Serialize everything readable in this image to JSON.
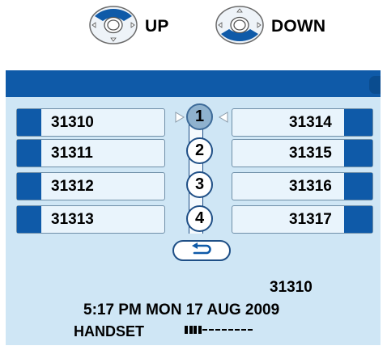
{
  "legend": {
    "up_label": "UP",
    "down_label": "DOWN",
    "up_icon": "nav-ring-up-icon",
    "down_icon": "nav-ring-down-icon"
  },
  "colors": {
    "header_blue": "#0f5aa8",
    "screen_background": "#cfe6f5",
    "key_face": "#e9f4fc",
    "selected_index": "#8fb2ce"
  },
  "line_keys": {
    "left": [
      "31310",
      "31311",
      "31312",
      "31313"
    ],
    "right": [
      "31314",
      "31315",
      "31316",
      "31317"
    ],
    "indices": [
      "1",
      "2",
      "3",
      "4"
    ],
    "selected_index": "1"
  },
  "back_button_icon": "return-arrow-icon",
  "status": {
    "extension": "31310",
    "datetime": "5:17 PM MON 17  AUG 2009",
    "mode": "HANDSET",
    "level_filled": 4,
    "level_total": 12
  }
}
